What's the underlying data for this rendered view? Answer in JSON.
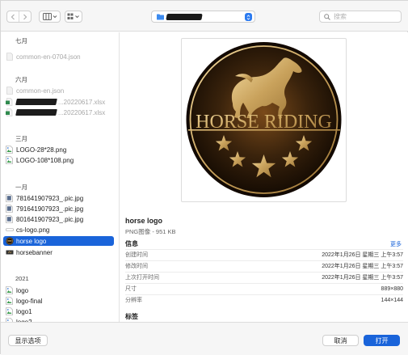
{
  "toolbar": {
    "search_placeholder": "搜索",
    "icons": {
      "back": "chevron-left-icon",
      "forward": "chevron-right-icon",
      "column_view": "column-view-icon",
      "grid_view": "grid-view-icon",
      "location_folder": "folder-icon",
      "location_stepper": "up-down-stepper-icon",
      "search": "magnifier-icon"
    },
    "accent": "#2c7bf0"
  },
  "sidebar": {
    "sections": [
      {
        "label": "七月",
        "items": [
          {
            "name": "common-en-0704.json",
            "dim": true,
            "icon": "json"
          }
        ]
      },
      {
        "label": "六月",
        "items": [
          {
            "name": "common-en.json",
            "dim": true,
            "icon": "json"
          },
          {
            "name": "...20220617.xlsx",
            "dim": true,
            "icon": "xlsx",
            "redacted": true
          },
          {
            "name": "...20220617.xlsx",
            "dim": true,
            "icon": "xlsx",
            "redacted": true
          }
        ]
      },
      {
        "label": "三月",
        "items": [
          {
            "name": "LOGO-28*28.png",
            "dim": false,
            "icon": "image"
          },
          {
            "name": "LOGO-108*108.png",
            "dim": false,
            "icon": "image"
          }
        ]
      },
      {
        "label": "一月",
        "items": [
          {
            "name": "781641907923_.pic.jpg",
            "dim": false,
            "icon": "jpg"
          },
          {
            "name": "791641907923_.pic.jpg",
            "dim": false,
            "icon": "jpg"
          },
          {
            "name": "801641907923_.pic.jpg",
            "dim": false,
            "icon": "jpg"
          },
          {
            "name": "cs-logo.png",
            "dim": false,
            "icon": "image"
          },
          {
            "name": "horse logo",
            "dim": false,
            "icon": "logo",
            "selected": true
          },
          {
            "name": "horsebanner",
            "dim": false,
            "icon": "banner"
          }
        ]
      },
      {
        "label": "2021",
        "items": [
          {
            "name": "logo",
            "dim": false,
            "icon": "image"
          },
          {
            "name": "logo-final",
            "dim": false,
            "icon": "image"
          },
          {
            "name": "logo1",
            "dim": false,
            "icon": "image"
          },
          {
            "name": "logo2",
            "dim": false,
            "icon": "image"
          }
        ]
      }
    ],
    "selected_color": "#1a64da"
  },
  "preview": {
    "logo_text": "HORSE RIDING",
    "file_name": "horse logo",
    "file_kind": "PNG图像 - 951 KB",
    "info_title": "信息",
    "more_label": "更多",
    "info_rows": [
      {
        "key": "创建时间",
        "value": "2022年1月26日 星期三 上午3:57"
      },
      {
        "key": "修改时间",
        "value": "2022年1月26日 星期三 上午3:57"
      },
      {
        "key": "上次打开时间",
        "value": "2022年1月26日 星期三 上午3:57"
      },
      {
        "key": "尺寸",
        "value": "889×880"
      },
      {
        "key": "分辨率",
        "value": "144×144"
      }
    ],
    "tags_title": "标签",
    "gold": "#c9a25c",
    "dark": "#2a1a08"
  },
  "footer": {
    "show_options": "显示选项",
    "cancel": "取消",
    "open": "打开"
  }
}
